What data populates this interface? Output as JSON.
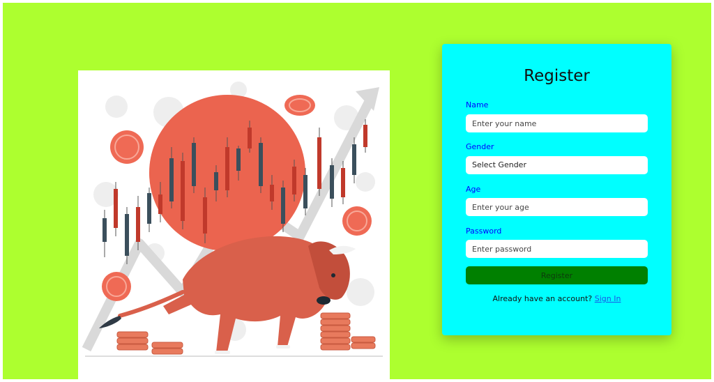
{
  "colors": {
    "page_bg": "#adff2f",
    "card_bg": "#00ffff",
    "label_color": "#0000ff",
    "button_bg": "#008000",
    "link_color": "#1a55e6"
  },
  "illustration": {
    "icon": "bull-market-illustration"
  },
  "form": {
    "title": "Register",
    "name": {
      "label": "Name",
      "placeholder": "Enter your name"
    },
    "gender": {
      "label": "Gender",
      "selected": "Select Gender"
    },
    "age": {
      "label": "Age",
      "placeholder": "Enter your age"
    },
    "password": {
      "label": "Password",
      "placeholder": "Enter password"
    },
    "submit_label": "Register",
    "signin_prompt": "Already have an account?",
    "signin_link": "Sign In"
  }
}
